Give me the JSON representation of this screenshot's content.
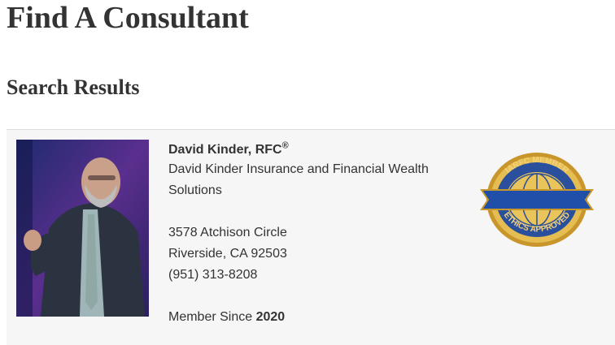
{
  "page": {
    "title": "Find A Consultant"
  },
  "results": {
    "heading": "Search Results",
    "consultant": {
      "name": "David Kinder, RFC",
      "name_superscript": "®",
      "company_line1": "David Kinder Insurance and Financial Wealth",
      "company_line2": "Solutions",
      "address_line1": "3578 Atchison Circle",
      "address_line2": "Riverside, CA 92503",
      "phone": "(951) 313-8208",
      "member_since_label": "Member Since",
      "member_since_year": "2020",
      "seal": {
        "top_text": "IARFC MEMBER",
        "bottom_text": "ETHICS APPROVED"
      }
    }
  },
  "colors": {
    "card_background": "#f6f6f6",
    "seal_gold": "#c8962a",
    "seal_blue": "#2a4f9c"
  }
}
